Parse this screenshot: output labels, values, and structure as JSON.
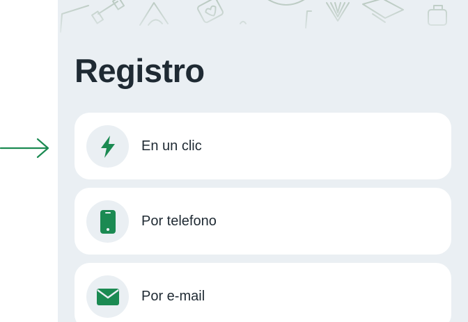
{
  "page": {
    "title": "Registro"
  },
  "colors": {
    "accent": "#1b8a52",
    "panel_background": "#eaeff3",
    "card_background": "#ffffff",
    "text_primary": "#1f2a33"
  },
  "options": [
    {
      "label": "En un clic",
      "icon": "lightning-bolt-icon"
    },
    {
      "label": "Por telefono",
      "icon": "smartphone-icon"
    },
    {
      "label": "Por e-mail",
      "icon": "envelope-icon"
    }
  ],
  "pointer": {
    "icon": "right-arrow-icon"
  }
}
